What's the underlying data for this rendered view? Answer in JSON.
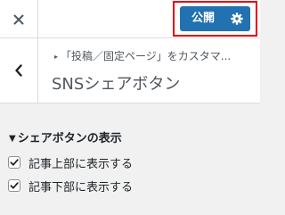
{
  "header": {
    "close_icon": "close-icon",
    "publish_label": "公開",
    "settings_icon": "gear-icon",
    "highlight_color": "#e60012",
    "publish_color": "#2271b1"
  },
  "section": {
    "back_icon": "chevron-left-icon",
    "breadcrumb": "「投稿／固定ページ」をカスタマ...",
    "title": "SNSシェアボタン"
  },
  "group": {
    "title": "シェアボタンの表示",
    "options": [
      {
        "label": "記事上部に表示する",
        "checked": true
      },
      {
        "label": "記事下部に表示する",
        "checked": true
      }
    ]
  }
}
